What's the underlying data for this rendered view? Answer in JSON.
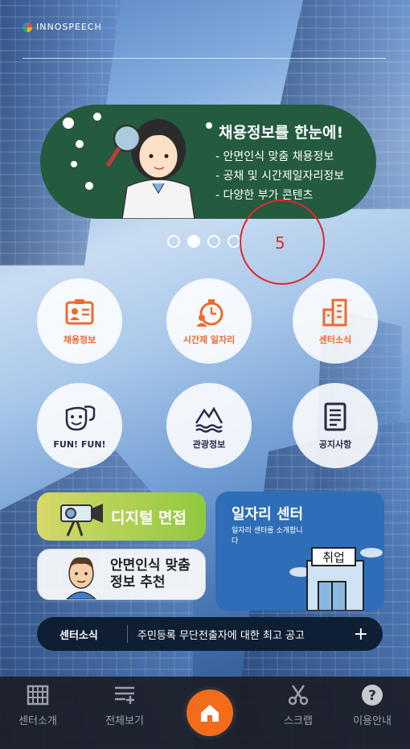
{
  "logo": {
    "text": "INNOSPEECH"
  },
  "banner": {
    "title": "채용정보를 한눈에!",
    "lines": [
      "- 안면인식 맞춤 채용정보",
      "- 공채 및 시간제일자리정보",
      "- 다양한 부가 콘텐츠"
    ],
    "indicators": {
      "count": 4,
      "active_index": 1
    },
    "annotation_number": "5"
  },
  "menu": [
    {
      "label": "채용정보",
      "icon": "id-card-icon"
    },
    {
      "label": "시간제 일자리",
      "icon": "clock-person-icon"
    },
    {
      "label": "센터소식",
      "icon": "building-icon"
    },
    {
      "label": "FUN! FUN!",
      "icon": "mask-icon"
    },
    {
      "label": "관광정보",
      "icon": "mountain-icon"
    },
    {
      "label": "공지사항",
      "icon": "document-icon"
    }
  ],
  "cards": {
    "interview": "디지털 면접",
    "face": [
      "안면인식 맞춤",
      "정보 추천"
    ],
    "center": {
      "title": "일자리 센터",
      "subtitle": "일자리 센터를 소개합니다",
      "sign": "취업"
    }
  },
  "news": {
    "label": "센터소식",
    "text": "주민등록 무단전출자에 대한 최고 공고",
    "plus": "+"
  },
  "nav": [
    {
      "label": "센터소개",
      "icon": "building-grid-icon"
    },
    {
      "label": "전체보기",
      "icon": "list-add-icon"
    },
    {
      "label": "",
      "icon": "home-icon"
    },
    {
      "label": "스크랩",
      "icon": "scissors-icon"
    },
    {
      "label": "이용안내",
      "icon": "help-icon"
    }
  ],
  "colors": {
    "accent": "#f26c1a",
    "banner_bg": "#245a3e",
    "menu_orange": "#ef6a2e",
    "center_card": "#2e6db7"
  }
}
